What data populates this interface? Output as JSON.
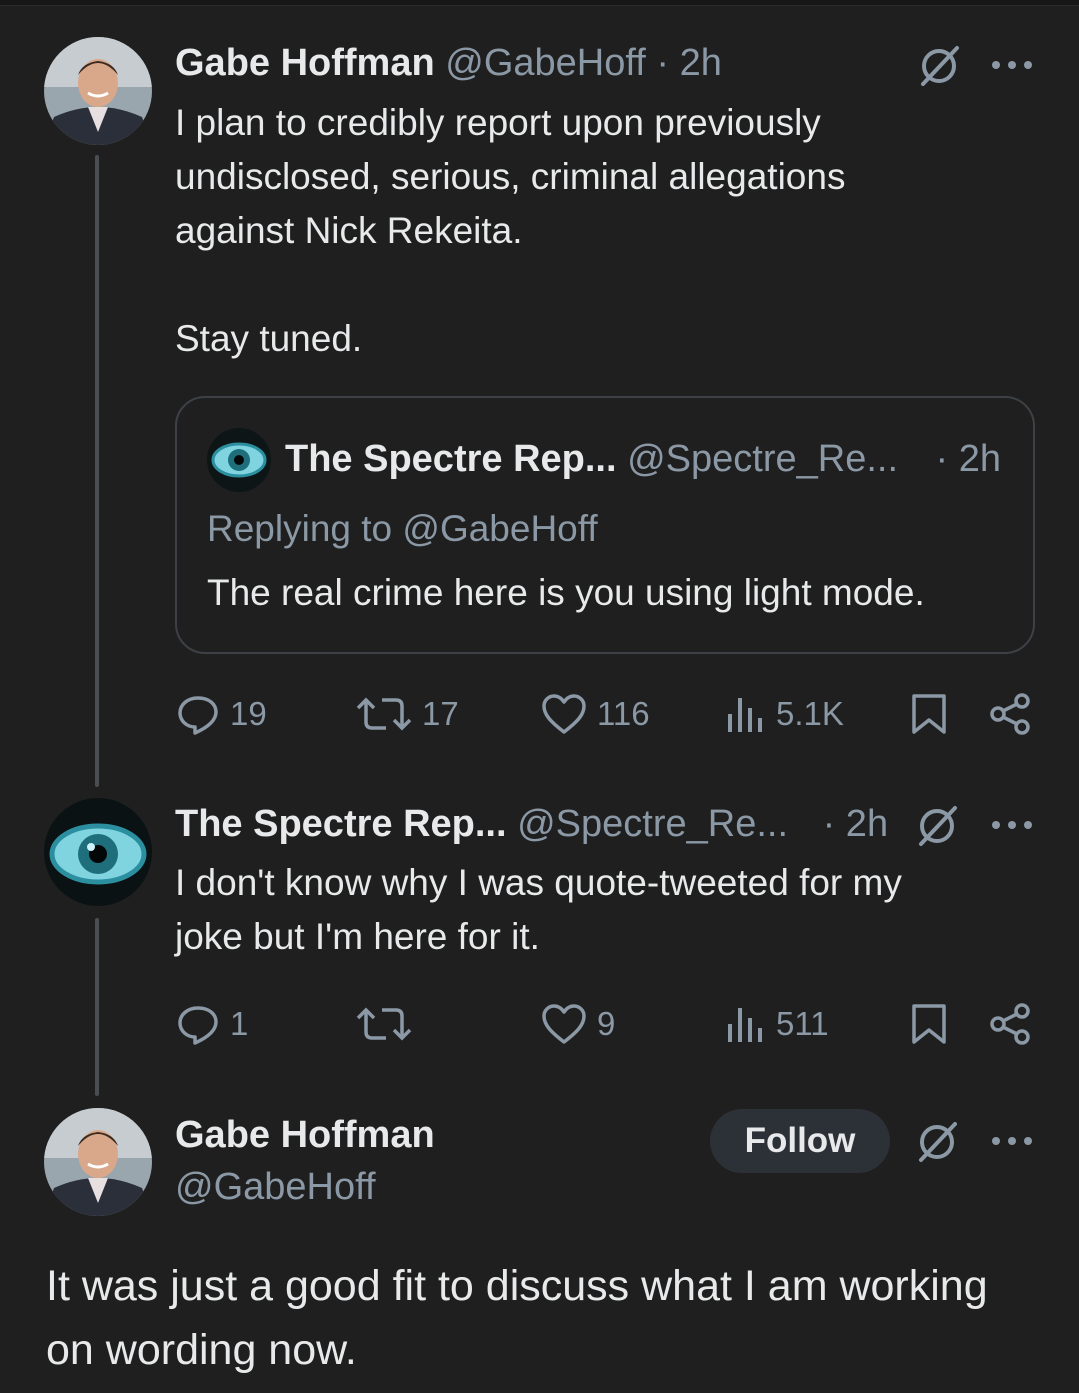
{
  "tweet1": {
    "name": "Gabe Hoffman",
    "handle": "@GabeHoff",
    "time": "· 2h",
    "text": "I plan to credibly report upon previously\nundisclosed, serious, criminal allegations\nagainst Nick Rekeita.\n\nStay tuned.",
    "quote": {
      "name": "The Spectre Rep...",
      "handle": "@Spectre_Re...",
      "time": "· 2h",
      "replying_to": "Replying to @GabeHoff",
      "text": "The real crime here is you using light mode."
    },
    "actions": {
      "replies": "19",
      "reposts": "17",
      "likes": "116",
      "views": "5.1K"
    }
  },
  "tweet2": {
    "name": "The Spectre Rep...",
    "handle": "@Spectre_Re...",
    "time": "· 2h",
    "text": "I don't know why I was quote-tweeted for my\njoke but I'm here for it.",
    "actions": {
      "replies": "1",
      "reposts": "",
      "likes": "9",
      "views": "511"
    }
  },
  "tweet3": {
    "name": "Gabe Hoffman",
    "handle": "@GabeHoff",
    "follow_label": "Follow",
    "text": "It was just a good fit to discuss what I am working on wording now."
  },
  "icons": {
    "more": "more-dots-icon",
    "grok": "grok-icon",
    "reply": "reply-icon",
    "repost": "repost-icon",
    "like": "like-icon",
    "views": "views-icon",
    "bookmark": "bookmark-icon",
    "share": "share-icon"
  },
  "colors": {
    "background": "#1f1f1f",
    "muted": "#8b98a5",
    "text": "#e7e9ea"
  }
}
